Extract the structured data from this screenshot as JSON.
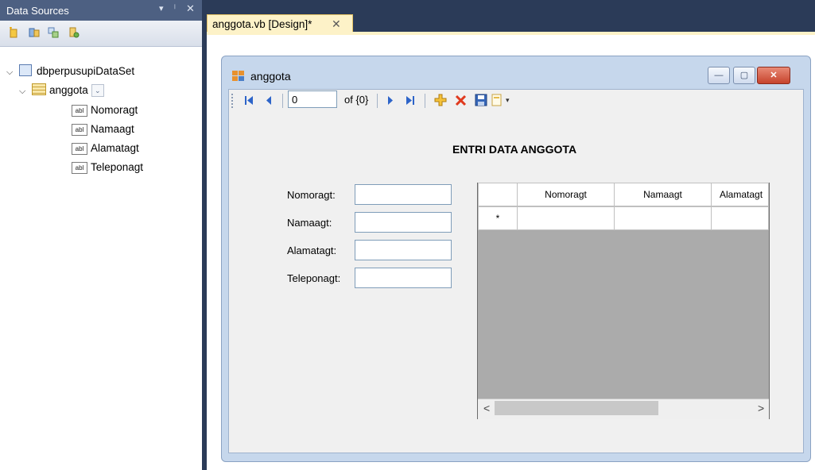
{
  "data_sources": {
    "title": "Data Sources",
    "dropdown_glyph": "▾",
    "pin_glyph": "ᛌ",
    "close_glyph": "✕",
    "toolbar_icons": [
      "add-data-source-icon",
      "edit-dataset-icon",
      "configure-dataset-icon",
      "refresh-icon"
    ],
    "tree": {
      "dataset": "dbperpusupiDataSet",
      "table": "anggota",
      "fields": [
        "Nomoragt",
        "Namaagt",
        "Alamatagt",
        "Teleponagt"
      ],
      "field_icon_text": "abl",
      "expand_glyph": "⌄"
    }
  },
  "document_tab": {
    "label": "anggota.vb [Design]*",
    "close_glyph": "✕"
  },
  "form": {
    "title": "anggota",
    "window_buttons": {
      "minimize": "—",
      "maximize": "▢",
      "close": "✕"
    },
    "navigator": {
      "position_value": "0",
      "count_text": "of {0}",
      "icons": [
        "move-first-icon",
        "move-previous-icon",
        "move-next-icon",
        "move-last-icon",
        "add-new-icon",
        "delete-icon",
        "save-icon",
        "print-icon"
      ]
    },
    "heading": "ENTRI DATA ANGGOTA",
    "fields": [
      {
        "label": "Nomoragt:",
        "value": ""
      },
      {
        "label": "Namaagt:",
        "value": ""
      },
      {
        "label": "Alamatagt:",
        "value": ""
      },
      {
        "label": "Teleponagt:",
        "value": ""
      }
    ],
    "grid": {
      "columns": [
        "Nomoragt",
        "Namaagt",
        "Alamatagt"
      ],
      "new_row_marker": "*"
    }
  },
  "colors": {
    "ide_background": "#2b3b58",
    "panel_header": "#4d6082",
    "tab_active": "#fdf2c8",
    "form_frame": "#c6d7ec",
    "form_client": "#f0f0f0",
    "grid_background": "#ababab"
  }
}
